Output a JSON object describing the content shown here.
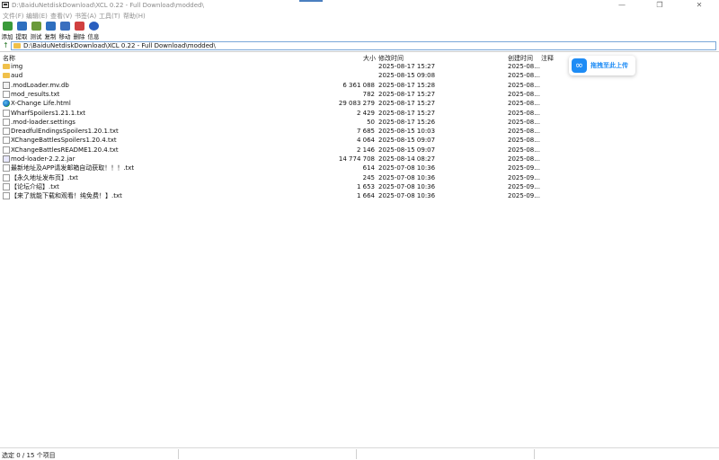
{
  "window": {
    "title": "D:\\BaiduNetdiskDownload\\XCL 0.22 - Full Download\\modded\\",
    "controls": {
      "minimize": "—",
      "maximize": "❐",
      "close": "✕"
    }
  },
  "menu": [
    "文件(F)",
    "编辑(E)",
    "查看(V)",
    "书签(A)",
    "工具(T)",
    "帮助(H)"
  ],
  "toolbar": [
    {
      "label": "添加",
      "icon": "add-icon",
      "color": "#3a9a3a"
    },
    {
      "label": "提取",
      "icon": "extract-icon",
      "color": "#2f6fbf"
    },
    {
      "label": "测试",
      "icon": "test-icon",
      "color": "#6a9a3a"
    },
    {
      "label": "复制",
      "icon": "copy-icon",
      "color": "#2f6fbf"
    },
    {
      "label": "移动",
      "icon": "move-icon",
      "color": "#3a6fbf"
    },
    {
      "label": "删除",
      "icon": "delete-icon",
      "color": "#d04040"
    },
    {
      "label": "信息",
      "icon": "info-icon",
      "color": "#2a5fbf"
    }
  ],
  "address": {
    "path": "D:\\BaiduNetdiskDownload\\XCL 0.22 - Full Download\\modded\\"
  },
  "columns": {
    "name": "名称",
    "size": "大小",
    "modified": "修改时间",
    "created": "创建时间",
    "comment": "注释"
  },
  "files": [
    {
      "name": "img",
      "size": "",
      "modified": "2025-08-17 15:27",
      "created": "2025-08...",
      "icon": "folder"
    },
    {
      "name": "aud",
      "size": "",
      "modified": "2025-08-15 09:08",
      "created": "2025-08...",
      "icon": "folder"
    },
    {
      "name": ".modLoader.mv.db",
      "size": "6 361 088",
      "modified": "2025-08-17 15:28",
      "created": "2025-08...",
      "icon": "db"
    },
    {
      "name": "mod_results.txt",
      "size": "782",
      "modified": "2025-08-17 15:27",
      "created": "2025-08...",
      "icon": "file"
    },
    {
      "name": "X-Change Life.html",
      "size": "29 083 279",
      "modified": "2025-08-17 15:27",
      "created": "2025-08...",
      "icon": "html"
    },
    {
      "name": "WharfSpoilers1.21.1.txt",
      "size": "2 429",
      "modified": "2025-08-17 15:27",
      "created": "2025-08...",
      "icon": "file"
    },
    {
      "name": ".mod-loader.settings",
      "size": "50",
      "modified": "2025-08-17 15:26",
      "created": "2025-08...",
      "icon": "file"
    },
    {
      "name": "DreadfulEndingsSpoilers1.20.1.txt",
      "size": "7 685",
      "modified": "2025-08-15 10:03",
      "created": "2025-08...",
      "icon": "file"
    },
    {
      "name": "XChangeBattlesSpoilers1.20.4.txt",
      "size": "4 064",
      "modified": "2025-08-15 09:07",
      "created": "2025-08...",
      "icon": "file"
    },
    {
      "name": "XChangeBattlesREADME1.20.4.txt",
      "size": "2 146",
      "modified": "2025-08-15 09:07",
      "created": "2025-08...",
      "icon": "file"
    },
    {
      "name": "mod-loader-2.2.2.jar",
      "size": "14 774 708",
      "modified": "2025-08-14 08:27",
      "created": "2025-08...",
      "icon": "jar"
    },
    {
      "name": "最新地址及APP请发邮箱自动获取！！！.txt",
      "size": "614",
      "modified": "2025-07-08 10:36",
      "created": "2025-09...",
      "icon": "file"
    },
    {
      "name": "【永久地址发布页】.txt",
      "size": "245",
      "modified": "2025-07-08 10:36",
      "created": "2025-09...",
      "icon": "file"
    },
    {
      "name": "【论坛介绍】.txt",
      "size": "1 653",
      "modified": "2025-07-08 10:36",
      "created": "2025-09...",
      "icon": "file"
    },
    {
      "name": "【来了就能下载和观看！纯免费！】.txt",
      "size": "1 664",
      "modified": "2025-07-08 10:36",
      "created": "2025-09...",
      "icon": "file"
    }
  ],
  "upload_widget": {
    "label": "拖拽至此上传",
    "icon": "baidu-netdisk-icon"
  },
  "status": {
    "selection": "选定 0 / 15 个项目"
  }
}
